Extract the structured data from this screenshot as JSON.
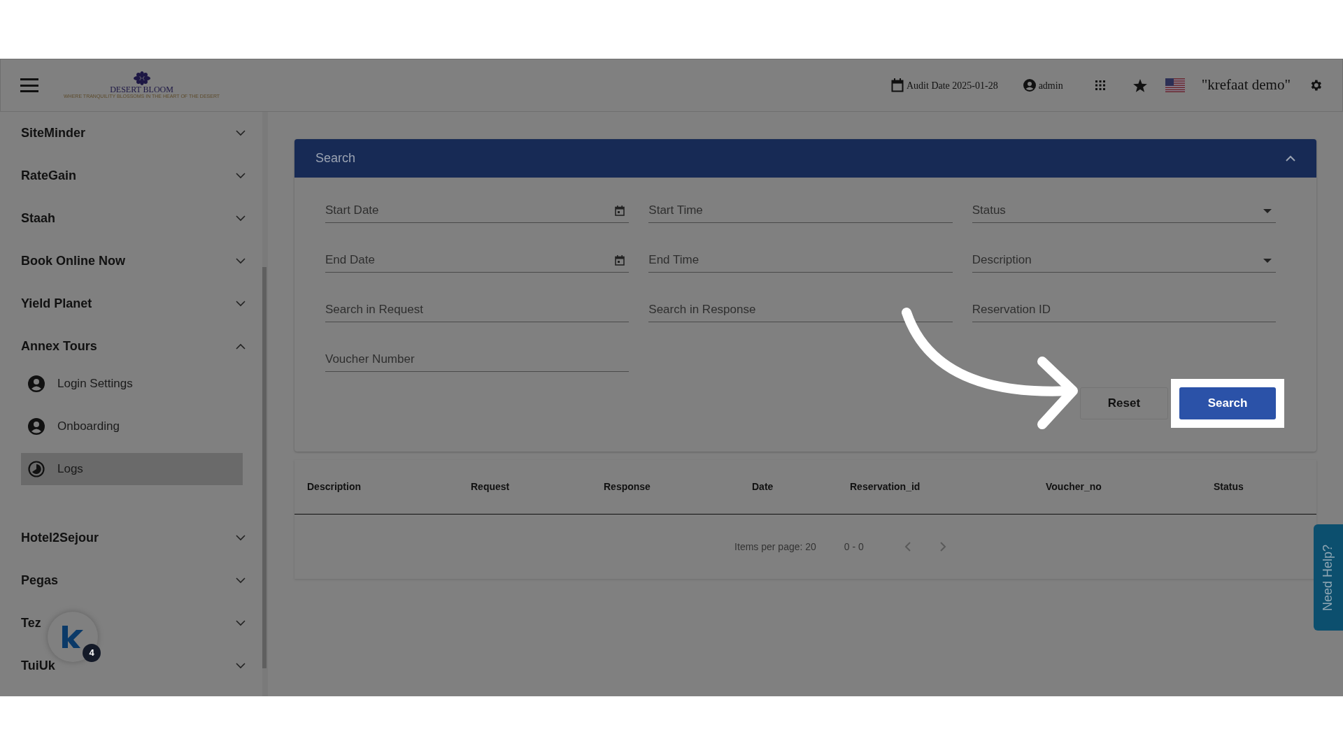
{
  "header": {
    "logo_name": "DESERT BLOOM",
    "logo_tagline": "WHERE TRANQUILITY BLOSSOMS IN THE HEART OF THE DESERT",
    "audit_date": "Audit Date 2025-01-28",
    "user": "admin",
    "company": "\"krefaat demo\""
  },
  "sidebar": {
    "items": [
      {
        "label": "SiteMinder",
        "expanded": false
      },
      {
        "label": "RateGain",
        "expanded": false
      },
      {
        "label": "Staah",
        "expanded": false
      },
      {
        "label": "Book Online Now",
        "expanded": false
      },
      {
        "label": "Yield Planet",
        "expanded": false
      },
      {
        "label": "Annex Tours",
        "expanded": true,
        "children": [
          {
            "label": "Login Settings",
            "kind": "person",
            "selected": false
          },
          {
            "label": "Onboarding",
            "kind": "person",
            "selected": false
          },
          {
            "label": "Logs",
            "kind": "clock",
            "selected": true
          }
        ]
      },
      {
        "label": "Hotel2Sejour",
        "expanded": false
      },
      {
        "label": "Pegas",
        "expanded": false
      },
      {
        "label": "Tez",
        "expanded": false
      },
      {
        "label": "TuiUk",
        "expanded": false
      }
    ]
  },
  "search_panel": {
    "title": "Search",
    "expanded": true,
    "fields": [
      {
        "placeholder": "Start Date",
        "kind": "date"
      },
      {
        "placeholder": "Start Time",
        "kind": "text"
      },
      {
        "placeholder": "Status",
        "kind": "select"
      },
      {
        "placeholder": "End Date",
        "kind": "date"
      },
      {
        "placeholder": "End Time",
        "kind": "text"
      },
      {
        "placeholder": "Description",
        "kind": "select"
      },
      {
        "placeholder": "Search in Request",
        "kind": "text"
      },
      {
        "placeholder": "Search in Response",
        "kind": "text"
      },
      {
        "placeholder": "Reservation ID",
        "kind": "text"
      },
      {
        "placeholder": "Voucher Number",
        "kind": "text"
      }
    ],
    "buttons": [
      {
        "label": "Reset",
        "kind": "secondary"
      },
      {
        "label": "Search",
        "kind": "primary"
      }
    ]
  },
  "table": {
    "columns": [
      "Description",
      "Request",
      "Response",
      "Date",
      "Reservation_id",
      "Voucher_no",
      "Status"
    ]
  },
  "pagination": {
    "items_per_page": "Items per page: 20",
    "range": "0 - 0"
  },
  "help_tab": "Need Help?",
  "chat_badge": "4"
}
